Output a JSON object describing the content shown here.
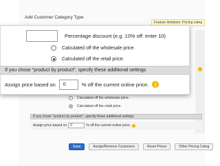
{
  "page": {
    "title": "Add Customer Category Type",
    "feature_notice": "Feature limitation: Pricing categ"
  },
  "zoom": {
    "percentage_label": "Percentage discount (e.g. 10% off: enter 10)",
    "percentage_value": "",
    "radio_wholesale": "Calculated off the wholesale price.",
    "radio_retail": "Calculated off the retail price.",
    "selected_option": "retail",
    "section_header": "If you chose \"product by product\", specify these additional settings",
    "assign_prefix": "Assign price based on",
    "assign_value": "0",
    "assign_suffix": "% off the current online price.",
    "help_icon_glyph": "i"
  },
  "background": {
    "radio_wholesale": "Calculated off the wholesale price.",
    "radio_retail": "Calculated off the retail price.",
    "section_header": "If you chose \"product by product\", specify these additional settings",
    "assign_prefix": "Assign price based on",
    "assign_value": "0",
    "assign_suffix": "% off the current online price."
  },
  "footer": {
    "save": "Save",
    "assign_remove": "Assign/Remove Customers",
    "reset_prices": "Reset Prices",
    "other_pricing": "Other Pricing Categ"
  },
  "colors": {
    "primary_button": "#2f6ec2",
    "section_bg": "#dcdcdc",
    "help_icon": "#f2b600"
  },
  "icons": {
    "help": "info-icon"
  }
}
